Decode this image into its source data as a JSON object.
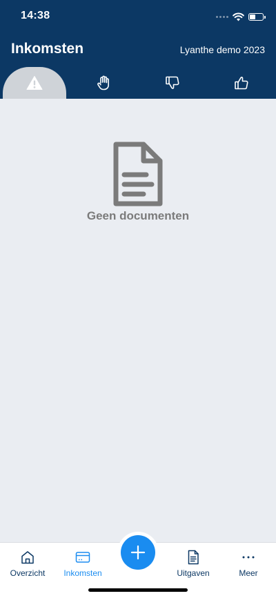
{
  "status_bar": {
    "time": "14:38",
    "icons": [
      "signal-dots-icon",
      "wifi-icon",
      "battery-icon"
    ]
  },
  "header": {
    "title": "Inkomsten",
    "organization": "Lyanthe demo 2023"
  },
  "tabs": [
    {
      "icon": "warning-icon",
      "active": true
    },
    {
      "icon": "hand-icon",
      "active": false
    },
    {
      "icon": "thumbs-down-icon",
      "active": false
    },
    {
      "icon": "thumbs-up-icon",
      "active": false
    }
  ],
  "empty_state": {
    "icon": "document-icon",
    "message": "Geen documenten"
  },
  "bottom_nav": {
    "items": [
      {
        "label": "Overzicht",
        "icon": "home-icon",
        "active": false
      },
      {
        "label": "Inkomsten",
        "icon": "card-icon",
        "active": true
      },
      {
        "label": "Uitgaven",
        "icon": "document-icon",
        "active": false
      },
      {
        "label": "Meer",
        "icon": "more-icon",
        "active": false
      }
    ],
    "fab_icon": "plus-icon"
  },
  "colors": {
    "header_bg": "#0c3864",
    "body_bg": "#eaedf2",
    "accent": "#1a8cf0",
    "active_tab_bg": "#cfd3d8",
    "empty_state": "#7b7b7b"
  }
}
